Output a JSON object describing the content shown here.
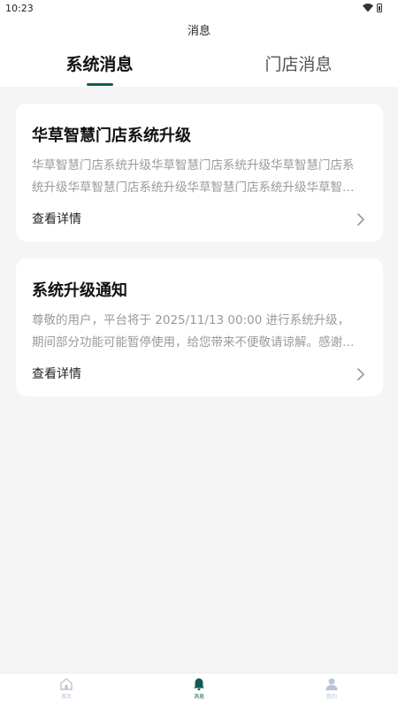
{
  "status_bar": {
    "time": "10:23"
  },
  "header": {
    "title": "消息"
  },
  "tabs": [
    {
      "label": "系统消息",
      "active": true
    },
    {
      "label": "门店消息",
      "active": false
    }
  ],
  "messages": [
    {
      "title": "华草智慧门店系统升级",
      "description": "华草智慧门店系统升级华草智慧门店系统升级华草智慧门店系统升级华草智慧门店系统升级华草智慧门店系统升级华草智慧门店系统升级",
      "link": "查看详情"
    },
    {
      "title": "系统升级通知",
      "description": "尊敬的用户，平台将于 2025/11/13 00:00 进行系统升级，期间部分功能可能暂停使用，给您带来不便敬请谅解。感谢您的支持",
      "link": "查看详情"
    }
  ],
  "bottom_nav": [
    {
      "label": "首页",
      "icon": "home-icon",
      "active": false
    },
    {
      "label": "消息",
      "icon": "bell-icon",
      "active": true
    },
    {
      "label": "我的",
      "icon": "user-icon",
      "active": false
    }
  ],
  "colors": {
    "accent": "#0e5c51",
    "inactive_nav": "#b9c4d4",
    "background": "#f5f5f5"
  }
}
